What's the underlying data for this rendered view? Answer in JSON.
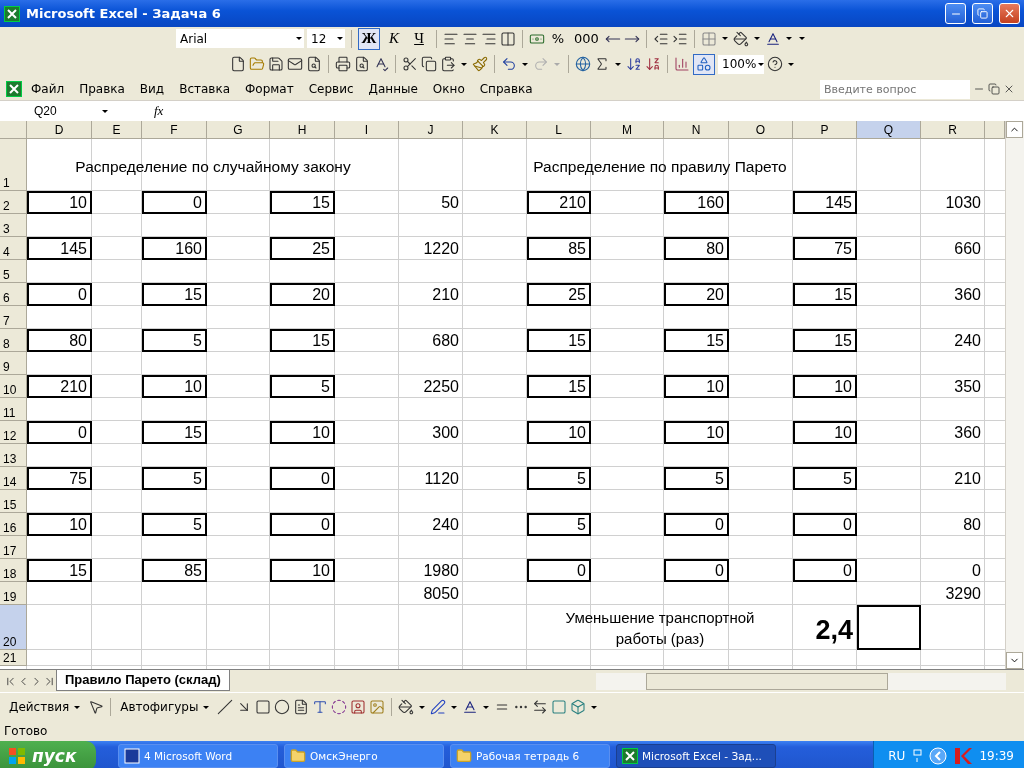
{
  "window": {
    "title": "Microsoft Excel - Задача 6"
  },
  "format_toolbar": {
    "font": "Arial",
    "size": "12",
    "bold": {
      "label": "Ж",
      "pressed": true
    },
    "italic": {
      "label": "К",
      "pressed": false
    },
    "underline": {
      "label": "Ч",
      "pressed": false
    },
    "percent": "%",
    "thousands": "000"
  },
  "standard_toolbar": {
    "zoom": "100%",
    "drawing_pressed": true,
    "redo_disabled": true
  },
  "menu": [
    "Файл",
    "Правка",
    "Вид",
    "Вставка",
    "Формат",
    "Сервис",
    "Данные",
    "Окно",
    "Справка"
  ],
  "help_search": {
    "placeholder": "Введите вопрос"
  },
  "formula_bar": {
    "name_box": "Q20",
    "fx": "fx"
  },
  "sheet": {
    "columns": [
      {
        "label": "D",
        "selected": false
      },
      {
        "label": "E",
        "selected": false
      },
      {
        "label": "F",
        "selected": false
      },
      {
        "label": "G",
        "selected": false
      },
      {
        "label": "H",
        "selected": false
      },
      {
        "label": "I",
        "selected": false
      },
      {
        "label": "J",
        "selected": false
      },
      {
        "label": "K",
        "selected": false
      },
      {
        "label": "L",
        "selected": false
      },
      {
        "label": "M",
        "selected": false
      },
      {
        "label": "N",
        "selected": false
      },
      {
        "label": "O",
        "selected": false
      },
      {
        "label": "P",
        "selected": false
      },
      {
        "label": "Q",
        "selected": true
      },
      {
        "label": "R",
        "selected": false
      }
    ],
    "rows": [
      {
        "number": "1",
        "selected": false,
        "cells": [
          {
            "kind": "heading",
            "text": "Распределение по случайному закону"
          },
          {
            "kind": "merged"
          },
          {
            "kind": "merged"
          },
          {
            "kind": "merged"
          },
          {
            "kind": "merged"
          },
          {
            "kind": "merged"
          },
          {
            "kind": "empty"
          },
          {
            "kind": "heading",
            "text": "Распределение по правилу Парето"
          },
          {
            "kind": "merged"
          },
          {
            "kind": "merged"
          },
          {
            "kind": "merged"
          },
          {
            "kind": "merged"
          },
          {
            "kind": "merged"
          }
        ]
      },
      {
        "number": "2",
        "selected": false,
        "cells": [
          {
            "kind": "boxed",
            "text": "10"
          },
          {
            "kind": "empty"
          },
          {
            "kind": "boxed",
            "text": "0"
          },
          {
            "kind": "empty"
          },
          {
            "kind": "boxed",
            "text": "15"
          },
          {
            "kind": "empty"
          },
          {
            "kind": "number",
            "text": "50"
          },
          {
            "kind": "empty"
          },
          {
            "kind": "boxed",
            "text": "210"
          },
          {
            "kind": "empty"
          },
          {
            "kind": "boxed",
            "text": "160"
          },
          {
            "kind": "empty"
          },
          {
            "kind": "boxed",
            "text": "145"
          },
          {
            "kind": "empty"
          },
          {
            "kind": "number",
            "text": "1030"
          }
        ]
      },
      {
        "number": "3",
        "selected": false
      },
      {
        "number": "4",
        "selected": false,
        "cells": [
          {
            "kind": "boxed",
            "text": "145"
          },
          {
            "kind": "empty"
          },
          {
            "kind": "boxed",
            "text": "160"
          },
          {
            "kind": "empty"
          },
          {
            "kind": "boxed",
            "text": "25"
          },
          {
            "kind": "empty"
          },
          {
            "kind": "number",
            "text": "1220"
          },
          {
            "kind": "empty"
          },
          {
            "kind": "boxed",
            "text": "85"
          },
          {
            "kind": "empty"
          },
          {
            "kind": "boxed",
            "text": "80"
          },
          {
            "kind": "empty"
          },
          {
            "kind": "boxed",
            "text": "75"
          },
          {
            "kind": "empty"
          },
          {
            "kind": "number",
            "text": "660"
          }
        ]
      },
      {
        "number": "5",
        "selected": false
      },
      {
        "number": "6",
        "selected": false,
        "cells": [
          {
            "kind": "boxed",
            "text": "0"
          },
          {
            "kind": "empty"
          },
          {
            "kind": "boxed",
            "text": "15"
          },
          {
            "kind": "empty"
          },
          {
            "kind": "boxed",
            "text": "20"
          },
          {
            "kind": "empty"
          },
          {
            "kind": "number",
            "text": "210"
          },
          {
            "kind": "empty"
          },
          {
            "kind": "boxed",
            "text": "25"
          },
          {
            "kind": "empty"
          },
          {
            "kind": "boxed",
            "text": "20"
          },
          {
            "kind": "empty"
          },
          {
            "kind": "boxed",
            "text": "15"
          },
          {
            "kind": "empty"
          },
          {
            "kind": "number",
            "text": "360"
          }
        ]
      },
      {
        "number": "7",
        "selected": false
      },
      {
        "number": "8",
        "selected": false,
        "cells": [
          {
            "kind": "boxed",
            "text": "80"
          },
          {
            "kind": "empty"
          },
          {
            "kind": "boxed",
            "text": "5"
          },
          {
            "kind": "empty"
          },
          {
            "kind": "boxed",
            "text": "15"
          },
          {
            "kind": "empty"
          },
          {
            "kind": "number",
            "text": "680"
          },
          {
            "kind": "empty"
          },
          {
            "kind": "boxed",
            "text": "15"
          },
          {
            "kind": "empty"
          },
          {
            "kind": "boxed",
            "text": "15"
          },
          {
            "kind": "empty"
          },
          {
            "kind": "boxed",
            "text": "15"
          },
          {
            "kind": "empty"
          },
          {
            "kind": "number",
            "text": "240"
          }
        ]
      },
      {
        "number": "9",
        "selected": false
      },
      {
        "number": "10",
        "selected": false,
        "cells": [
          {
            "kind": "boxed",
            "text": "210"
          },
          {
            "kind": "empty"
          },
          {
            "kind": "boxed",
            "text": "10"
          },
          {
            "kind": "empty"
          },
          {
            "kind": "boxed",
            "text": "5"
          },
          {
            "kind": "empty"
          },
          {
            "kind": "number",
            "text": "2250"
          },
          {
            "kind": "empty"
          },
          {
            "kind": "boxed",
            "text": "15"
          },
          {
            "kind": "empty"
          },
          {
            "kind": "boxed",
            "text": "10"
          },
          {
            "kind": "empty"
          },
          {
            "kind": "boxed",
            "text": "10"
          },
          {
            "kind": "empty"
          },
          {
            "kind": "number",
            "text": "350"
          }
        ]
      },
      {
        "number": "11",
        "selected": false
      },
      {
        "number": "12",
        "selected": false,
        "cells": [
          {
            "kind": "boxed",
            "text": "0"
          },
          {
            "kind": "empty"
          },
          {
            "kind": "boxed",
            "text": "15"
          },
          {
            "kind": "empty"
          },
          {
            "kind": "boxed",
            "text": "10"
          },
          {
            "kind": "empty"
          },
          {
            "kind": "number",
            "text": "300"
          },
          {
            "kind": "empty"
          },
          {
            "kind": "boxed",
            "text": "10"
          },
          {
            "kind": "empty"
          },
          {
            "kind": "boxed",
            "text": "10"
          },
          {
            "kind": "empty"
          },
          {
            "kind": "boxed",
            "text": "10"
          },
          {
            "kind": "empty"
          },
          {
            "kind": "number",
            "text": "360"
          }
        ]
      },
      {
        "number": "13",
        "selected": false
      },
      {
        "number": "14",
        "selected": false,
        "cells": [
          {
            "kind": "boxed",
            "text": "75"
          },
          {
            "kind": "empty"
          },
          {
            "kind": "boxed",
            "text": "5"
          },
          {
            "kind": "empty"
          },
          {
            "kind": "boxed",
            "text": "0"
          },
          {
            "kind": "empty"
          },
          {
            "kind": "number",
            "text": "1120"
          },
          {
            "kind": "empty"
          },
          {
            "kind": "boxed",
            "text": "5"
          },
          {
            "kind": "empty"
          },
          {
            "kind": "boxed",
            "text": "5"
          },
          {
            "kind": "empty"
          },
          {
            "kind": "boxed",
            "text": "5"
          },
          {
            "kind": "empty"
          },
          {
            "kind": "number",
            "text": "210"
          }
        ]
      },
      {
        "number": "15",
        "selected": false
      },
      {
        "number": "16",
        "selected": false,
        "cells": [
          {
            "kind": "boxed",
            "text": "10"
          },
          {
            "kind": "empty"
          },
          {
            "kind": "boxed",
            "text": "5"
          },
          {
            "kind": "empty"
          },
          {
            "kind": "boxed",
            "text": "0"
          },
          {
            "kind": "empty"
          },
          {
            "kind": "number",
            "text": "240"
          },
          {
            "kind": "empty"
          },
          {
            "kind": "boxed",
            "text": "5"
          },
          {
            "kind": "empty"
          },
          {
            "kind": "boxed",
            "text": "0"
          },
          {
            "kind": "empty"
          },
          {
            "kind": "boxed",
            "text": "0"
          },
          {
            "kind": "empty"
          },
          {
            "kind": "number",
            "text": "80"
          }
        ]
      },
      {
        "number": "17",
        "selected": false
      },
      {
        "number": "18",
        "selected": false,
        "cells": [
          {
            "kind": "boxed",
            "text": "15"
          },
          {
            "kind": "empty"
          },
          {
            "kind": "boxed",
            "text": "85"
          },
          {
            "kind": "empty"
          },
          {
            "kind": "boxed",
            "text": "10"
          },
          {
            "kind": "empty"
          },
          {
            "kind": "number",
            "text": "1980"
          },
          {
            "kind": "empty"
          },
          {
            "kind": "boxed",
            "text": "0"
          },
          {
            "kind": "empty"
          },
          {
            "kind": "boxed",
            "text": "0"
          },
          {
            "kind": "empty"
          },
          {
            "kind": "boxed",
            "text": "0"
          },
          {
            "kind": "empty"
          },
          {
            "kind": "number",
            "text": "0"
          }
        ]
      },
      {
        "number": "19",
        "selected": false,
        "cells": [
          {
            "kind": "empty"
          },
          {
            "kind": "empty"
          },
          {
            "kind": "empty"
          },
          {
            "kind": "empty"
          },
          {
            "kind": "empty"
          },
          {
            "kind": "empty"
          },
          {
            "kind": "number",
            "text": "8050"
          },
          {
            "kind": "empty"
          },
          {
            "kind": "empty"
          },
          {
            "kind": "empty"
          },
          {
            "kind": "empty"
          },
          {
            "kind": "empty"
          },
          {
            "kind": "empty"
          },
          {
            "kind": "empty"
          },
          {
            "kind": "number",
            "text": "3290"
          }
        ]
      },
      {
        "number": "20",
        "selected": true,
        "cells": [
          {
            "kind": "empty"
          },
          {
            "kind": "empty"
          },
          {
            "kind": "empty"
          },
          {
            "kind": "empty"
          },
          {
            "kind": "empty"
          },
          {
            "kind": "empty"
          },
          {
            "kind": "empty"
          },
          {
            "kind": "empty"
          },
          {
            "kind": "note",
            "text": "Уменьшение транспортной работы (раз)"
          },
          {
            "kind": "merged"
          },
          {
            "kind": "merged"
          },
          {
            "kind": "merged"
          },
          {
            "kind": "big",
            "text": "2,4"
          }
        ]
      },
      {
        "number": "21",
        "selected": false
      }
    ]
  },
  "sheet_tabs": [
    {
      "label": "Правило Парето (склад)",
      "selected": true
    }
  ],
  "drawing_toolbar": {
    "actions": "Действия",
    "autoshapes": "Автофигуры"
  },
  "status_bar": "Готово",
  "taskbar": {
    "start": "пуск",
    "tasks": [
      {
        "label": "4 Microsoft Word",
        "kind": "document",
        "selected": false
      },
      {
        "label": "ОмскЭнерго",
        "kind": "folder",
        "selected": false
      },
      {
        "label": "Рабочая тетрадь 6",
        "kind": "folder",
        "selected": false
      },
      {
        "label": "Microsoft Excel - Зад...",
        "kind": "spreadsheet",
        "selected": true
      }
    ],
    "language": "RU",
    "clock": "19:39"
  }
}
